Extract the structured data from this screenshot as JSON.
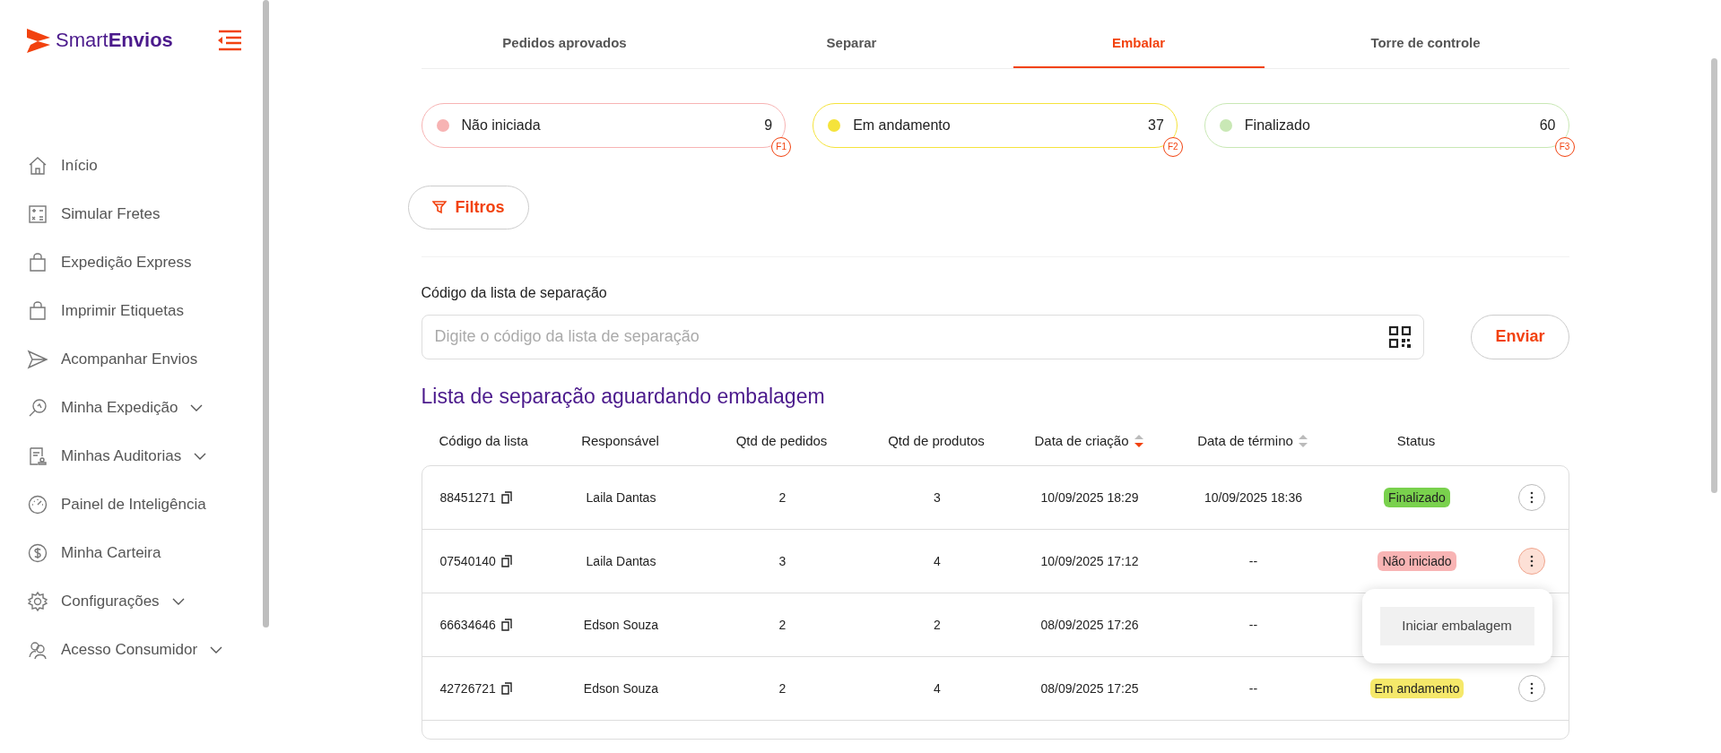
{
  "sidebar": {
    "logo": {
      "regular": "Smart",
      "bold": "Envios"
    },
    "items": [
      {
        "label": "Início",
        "expandable": false
      },
      {
        "label": "Simular Fretes",
        "expandable": false
      },
      {
        "label": "Expedição Express",
        "expandable": false
      },
      {
        "label": "Imprimir Etiquetas",
        "expandable": false
      },
      {
        "label": "Acompanhar Envios",
        "expandable": false
      },
      {
        "label": "Minha Expedição",
        "expandable": true
      },
      {
        "label": "Minhas Auditorias",
        "expandable": true
      },
      {
        "label": "Painel de Inteligência",
        "expandable": false
      },
      {
        "label": "Minha Carteira",
        "expandable": false
      },
      {
        "label": "Configurações",
        "expandable": true
      },
      {
        "label": "Acesso Consumidor",
        "expandable": true
      }
    ]
  },
  "tabs": [
    {
      "label": "Pedidos aprovados",
      "selected": false
    },
    {
      "label": "Separar",
      "selected": false
    },
    {
      "label": "Embalar",
      "selected": true
    },
    {
      "label": "Torre de controle",
      "selected": false
    }
  ],
  "status_cards": [
    {
      "label": "Não iniciada",
      "count": "9",
      "color": "#f7b3b3",
      "shortcut": "F1"
    },
    {
      "label": "Em andamento",
      "count": "37",
      "color": "#f5e33b",
      "shortcut": "F2"
    },
    {
      "label": "Finalizado",
      "count": "60",
      "color": "#c9e8b5",
      "shortcut": "F3"
    }
  ],
  "filters_button": "Filtros",
  "code_field": {
    "label": "Código da lista de separação",
    "placeholder": "Digite o código da lista de separação"
  },
  "send_button": "Enviar",
  "list_title": "Lista de separação aguardando embalagem",
  "table": {
    "columns": [
      {
        "label": "Código da lista"
      },
      {
        "label": "Responsável"
      },
      {
        "label": "Qtd de pedidos"
      },
      {
        "label": "Qtd de produtos"
      },
      {
        "label": "Data de criação",
        "sort_active": true
      },
      {
        "label": "Data de término",
        "sort_active": false
      },
      {
        "label": "Status"
      }
    ],
    "rows": [
      {
        "code": "88451271",
        "responsible": "Laila Dantas",
        "orders": "2",
        "products": "3",
        "created": "10/09/2025 18:29",
        "finished": "10/09/2025 18:36",
        "status": {
          "label": "Finalizado",
          "color": "#79d14d"
        },
        "menu_open": false
      },
      {
        "code": "07540140",
        "responsible": "Laila Dantas",
        "orders": "3",
        "products": "4",
        "created": "10/09/2025 17:12",
        "finished": "--",
        "status": {
          "label": "Não iniciado",
          "color": "#f8b4b4"
        },
        "menu_open": true
      },
      {
        "code": "66634646",
        "responsible": "Edson Souza",
        "orders": "2",
        "products": "2",
        "created": "08/09/2025 17:26",
        "finished": "--",
        "menu_open": false
      },
      {
        "code": "42726721",
        "responsible": "Edson Souza",
        "orders": "2",
        "products": "4",
        "created": "08/09/2025 17:25",
        "finished": "--",
        "status": {
          "label": "Em andamento",
          "color": "#f5e86a"
        },
        "menu_open": false
      }
    ]
  },
  "row_menu": {
    "items": [
      "Iniciar embalagem"
    ]
  }
}
